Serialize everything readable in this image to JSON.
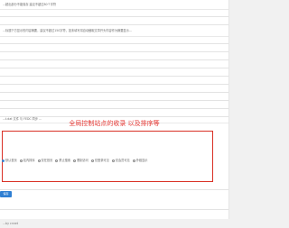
{
  "rows": {
    "r1": "...超出部分不能保存 建议不超过80个字符",
    "r2": "...标题下方显示的内容摘要，建议不超过150字符，如未填写将自动截取文章开头内容作为摘要显示...",
    "r3": "",
    "r4": "",
    "r5": "",
    "r6": "...",
    "r7": "...",
    "r8": "...t.dat 文件 与 FEDC 同步 ..."
  },
  "annotation": {
    "text": "全局控制站点的收录 以及排序等"
  },
  "options": [
    {
      "label": "默认首页",
      "checked": true
    },
    {
      "label": "站内排序",
      "checked": false
    },
    {
      "label": "仅在首页",
      "checked": false
    },
    {
      "label": "禁止搜索",
      "checked": false
    },
    {
      "label": "限制访问",
      "checked": false
    },
    {
      "label": "仅登录可见",
      "checked": false
    },
    {
      "label": "仅会员可见",
      "checked": false
    },
    {
      "label": "外链显示",
      "checked": false
    }
  ],
  "save": {
    "label": "保存"
  },
  "footer": {
    "text": "...by cnnet"
  }
}
